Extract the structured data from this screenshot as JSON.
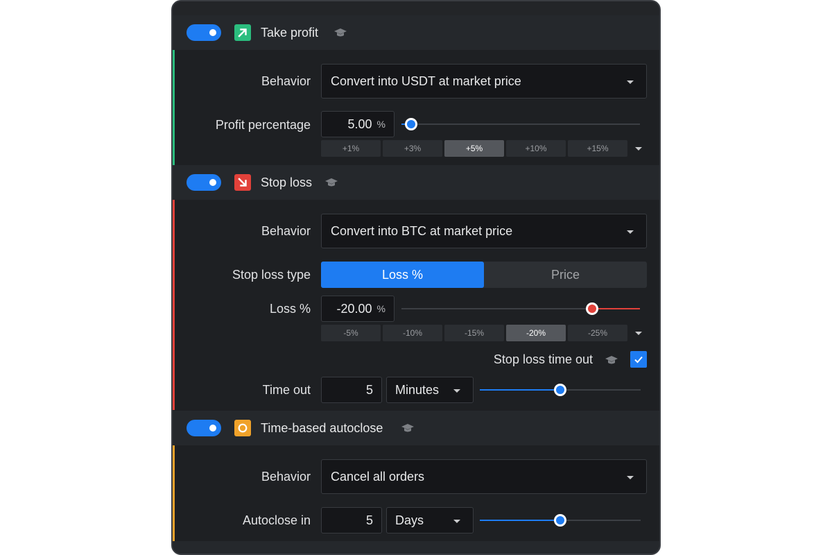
{
  "take_profit": {
    "title": "Take profit",
    "enabled": true,
    "behavior_label": "Behavior",
    "behavior_value": "Convert into USDT at market price",
    "percentage_label": "Profit percentage",
    "percentage_value": "5.00",
    "percentage_unit": "%",
    "slider_level": 0.04,
    "presets": [
      "+1%",
      "+3%",
      "+5%",
      "+10%",
      "+15%"
    ],
    "active_preset": "+5%",
    "accent_color": "#2bbd7e"
  },
  "stop_loss": {
    "title": "Stop loss",
    "enabled": true,
    "behavior_label": "Behavior",
    "behavior_value": "Convert into BTC at market price",
    "type_label": "Stop loss type",
    "type_options": [
      "Loss %",
      "Price"
    ],
    "type_selected": "Loss %",
    "loss_label": "Loss %",
    "loss_value": "-20.00",
    "loss_unit": "%",
    "slider_level": 0.8,
    "presets": [
      "-5%",
      "-10%",
      "-15%",
      "-20%",
      "-25%"
    ],
    "active_preset": "-20%",
    "timeout_toggle_label": "Stop loss time out",
    "timeout_checked": true,
    "timeout_label": "Time out",
    "timeout_value": "5",
    "timeout_unit": "Minutes",
    "timeout_slider_level": 0.5,
    "accent_color": "#e2413a"
  },
  "autoclose": {
    "title": "Time-based autoclose",
    "enabled": true,
    "behavior_label": "Behavior",
    "behavior_value": "Cancel all orders",
    "autoclose_label": "Autoclose in",
    "autoclose_value": "5",
    "autoclose_unit": "Days",
    "slider_level": 0.5,
    "accent_color": "#f0a22a"
  },
  "icons": {
    "take_profit": "arrow-up-right-icon",
    "stop_loss": "arrow-down-right-icon",
    "autoclose": "clock-circle-icon",
    "help": "graduation-cap-icon",
    "dropdown": "chevron-down-icon",
    "check": "check-icon"
  },
  "colors": {
    "primary_blue": "#1e7cf2",
    "panel_bg": "#1e2023",
    "input_bg": "#151619"
  }
}
